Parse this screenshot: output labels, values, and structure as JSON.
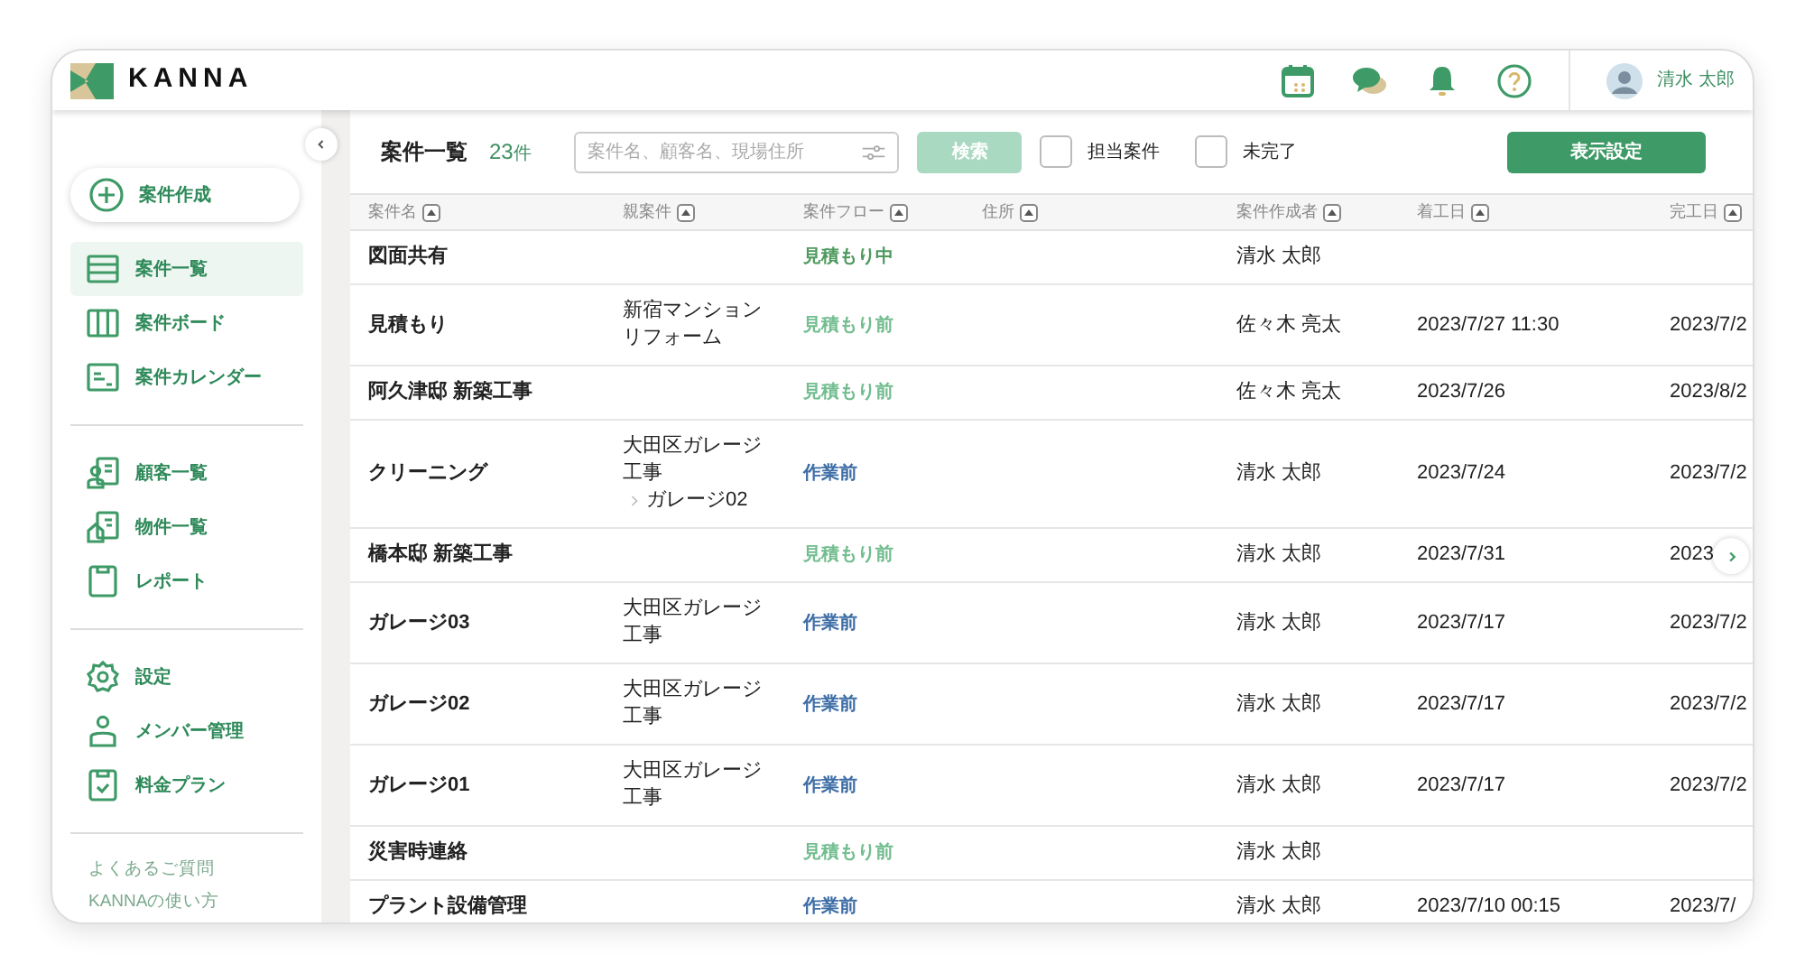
{
  "header": {
    "logo_text": "KANNA",
    "user_name": "清水 太郎"
  },
  "sidebar": {
    "create_button": "案件作成",
    "groups": [
      [
        {
          "label": "案件一覧",
          "selected": true
        },
        {
          "label": "案件ボード",
          "selected": false
        },
        {
          "label": "案件カレンダー",
          "selected": false
        }
      ],
      [
        {
          "label": "顧客一覧",
          "selected": false
        },
        {
          "label": "物件一覧",
          "selected": false
        },
        {
          "label": "レポート",
          "selected": false
        }
      ],
      [
        {
          "label": "設定",
          "selected": false
        },
        {
          "label": "メンバー管理",
          "selected": false
        },
        {
          "label": "料金プラン",
          "selected": false
        }
      ]
    ],
    "links": [
      "よくあるご質問",
      "KANNAの使い方"
    ]
  },
  "toolbar": {
    "title": "案件一覧",
    "count": "23",
    "count_unit": "件",
    "search": {
      "placeholder": "案件名、顧客名、現場住所"
    },
    "search_button": {
      "label": "検索",
      "disabled": true
    },
    "filters": [
      {
        "label": "担当案件",
        "checked": false
      },
      {
        "label": "未完了",
        "checked": false
      }
    ],
    "display_button": "表示設定"
  },
  "table": {
    "columns": [
      "案件名",
      "親案件",
      "案件フロー",
      "住所",
      "案件作成者",
      "着工日",
      "完工日"
    ],
    "rows": [
      {
        "name": "図面共有",
        "status": {
          "label": "見積もり中",
          "color": "#4e9a5e"
        },
        "creator": "清水 太郎"
      },
      {
        "name": "見積もり",
        "parent": "新宿マンションリフォーム",
        "status": {
          "label": "見積もり前",
          "color": "#72bd8f"
        },
        "creator": "佐々木 亮太",
        "start": "2023/7/27 11:30",
        "end": "2023/7/2"
      },
      {
        "name": "阿久津邸 新築工事",
        "status": {
          "label": "見積もり前",
          "color": "#72bd8f"
        },
        "creator": "佐々木 亮太",
        "start": "2023/7/26",
        "end": "2023/8/2"
      },
      {
        "name": "クリーニング",
        "parent": "大田区ガレージ工事",
        "parent_child": "ガレージ02",
        "status": {
          "label": "作業前",
          "color": "#3e6ea6"
        },
        "creator": "清水 太郎",
        "start": "2023/7/24",
        "end": "2023/7/2"
      },
      {
        "name": "橋本邸 新築工事",
        "status": {
          "label": "見積もり前",
          "color": "#72bd8f"
        },
        "creator": "清水 太郎",
        "start": "2023/7/31",
        "end": "2023"
      },
      {
        "name": "ガレージ03",
        "parent": "大田区ガレージ工事",
        "status": {
          "label": "作業前",
          "color": "#3e6ea6"
        },
        "creator": "清水 太郎",
        "start": "2023/7/17",
        "end": "2023/7/2"
      },
      {
        "name": "ガレージ02",
        "parent": "大田区ガレージ工事",
        "status": {
          "label": "作業前",
          "color": "#3e6ea6"
        },
        "creator": "清水 太郎",
        "start": "2023/7/17",
        "end": "2023/7/2"
      },
      {
        "name": "ガレージ01",
        "parent": "大田区ガレージ工事",
        "status": {
          "label": "作業前",
          "color": "#3e6ea6"
        },
        "creator": "清水 太郎",
        "start": "2023/7/17",
        "end": "2023/7/2"
      },
      {
        "name": "災害時連絡",
        "status": {
          "label": "見積もり前",
          "color": "#72bd8f"
        },
        "creator": "清水 太郎"
      },
      {
        "name": "プラント設備管理",
        "status": {
          "label": "作業前",
          "color": "#3e6ea6"
        },
        "creator": "清水 太郎",
        "start": "2023/7/10 00:15",
        "end": "2023/7/"
      }
    ]
  }
}
